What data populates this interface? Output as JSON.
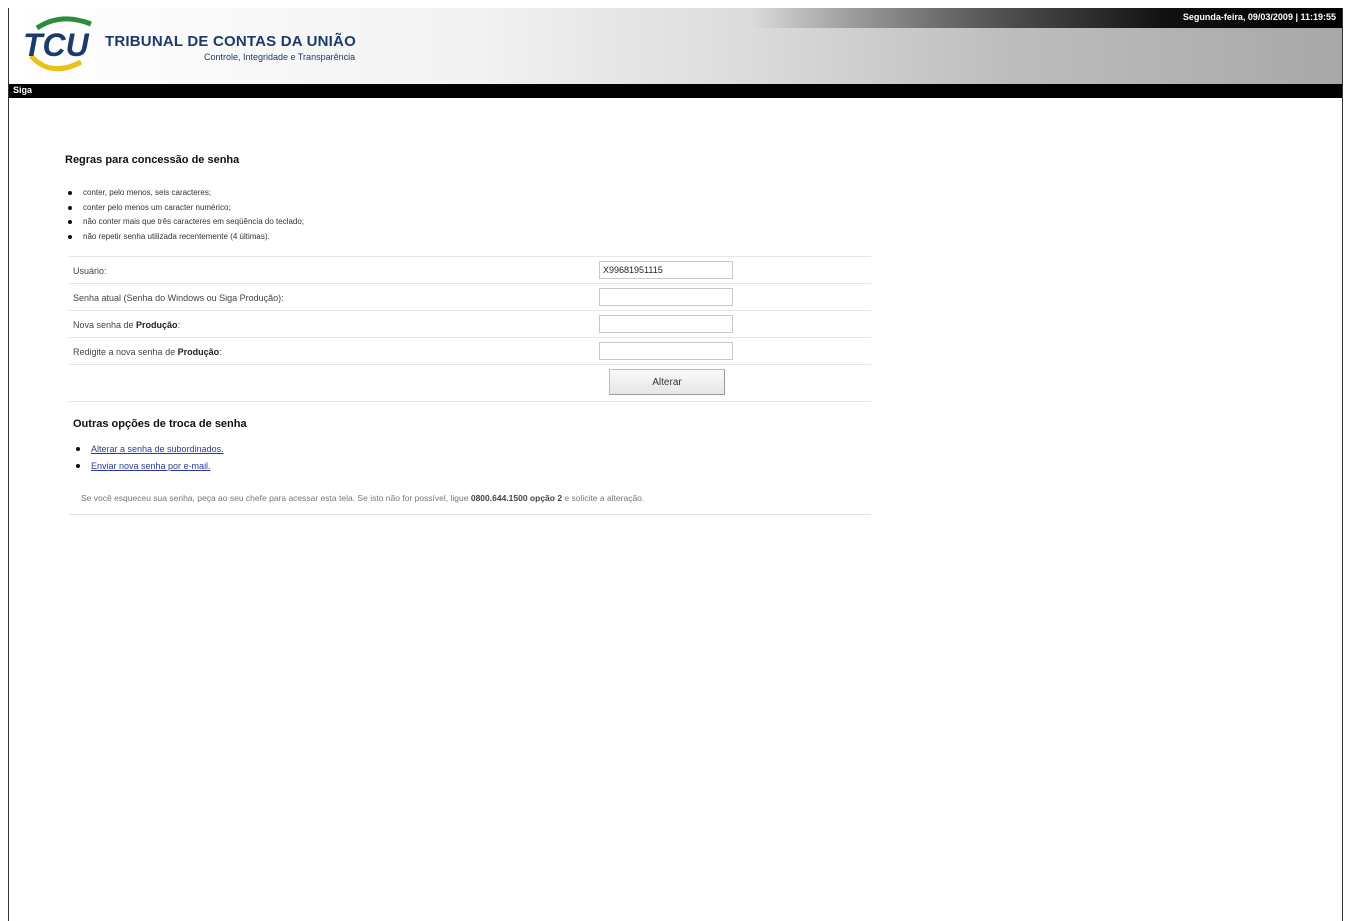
{
  "header": {
    "org_name": "TRIBUNAL DE CONTAS DA UNIÃO",
    "org_subtitle": "Controle, Integridade e Transparência",
    "datetime": "Segunda-feira, 09/03/2009 | 11:19:55",
    "logo_text": "TCU",
    "colors": {
      "logo_blue": "#1c3a6b",
      "logo_green": "#2e8b3d",
      "logo_yellow": "#e8c21a"
    }
  },
  "nav": {
    "label": "Siga"
  },
  "rules": {
    "title": "Regras para concessão de senha",
    "items": [
      "conter, pelo menos, seis caracteres;",
      "conter pelo menos um caracter numérico;",
      "não conter mais que três caracteres em seqüência do teclado;",
      "não repetir senha utilizada recentemente (4 últimas)."
    ]
  },
  "form": {
    "user_label": "Usuário:",
    "user_value": "X99681951115",
    "current_label": "Senha atual (Senha do Windows ou Siga Produção):",
    "current_value": "",
    "new_label_prefix": "Nova senha de ",
    "new_label_bold": "Produção",
    "new_label_suffix": ":",
    "new_value": "",
    "repeat_label_prefix": "Redigite a nova senha de ",
    "repeat_label_bold": "Produção",
    "repeat_label_suffix": ":",
    "repeat_value": "",
    "submit_label": "Alterar"
  },
  "other_options": {
    "title": "Outras opções de troca de senha",
    "links": [
      "Alterar a senha de subordinados.",
      "Enviar nova senha por e-mail."
    ],
    "help_prefix": "Se você esqueceu sua senha, peça ao seu chefe para acessar esta tela. Se isto não for possível, ligue ",
    "help_bold": "0800.644.1500 opção 2",
    "help_suffix": " e solicite a alteração."
  }
}
